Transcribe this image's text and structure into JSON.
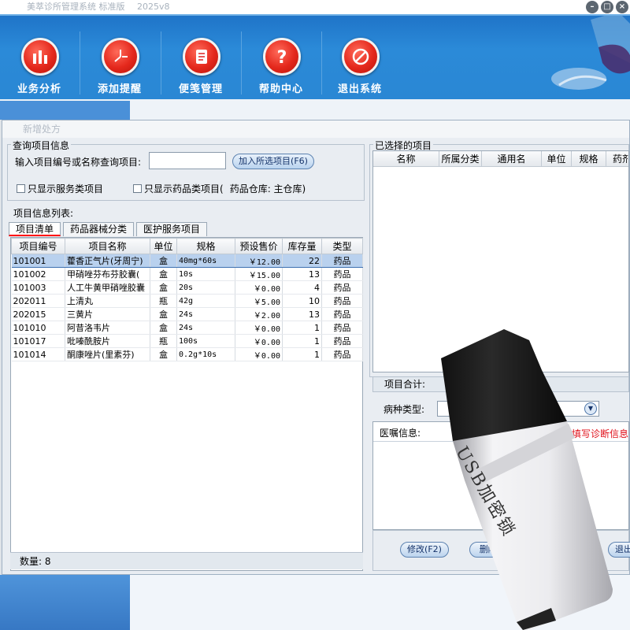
{
  "window": {
    "title": "美萃诊所管理系统 标准版",
    "version": "2025v8",
    "controls": [
      "minimize",
      "restore",
      "close"
    ]
  },
  "toolbar": {
    "buttons": [
      {
        "label": "业务分析",
        "icon": "bar-chart-icon"
      },
      {
        "label": "添加提醒",
        "icon": "clock-icon"
      },
      {
        "label": "便笺管理",
        "icon": "notepad-icon"
      },
      {
        "label": "帮助中心",
        "icon": "question-icon"
      },
      {
        "label": "退出系统",
        "icon": "no-entry-icon"
      }
    ]
  },
  "panel": {
    "title": "新增处方"
  },
  "query": {
    "group_title": "查询项目信息",
    "input_label": "输入项目编号或名称查询项目:",
    "input_value": "",
    "add_button": "加入所选项目(F6)",
    "only_service": "只显示服务类项目",
    "only_drug": "只显示药品类项目(",
    "warehouse": "药品仓库: 主仓库)"
  },
  "items": {
    "list_label": "项目信息列表:",
    "tabs": [
      "项目清单",
      "药品器械分类",
      "医护服务项目"
    ],
    "active_tab": 0,
    "columns": [
      "项目编号",
      "项目名称",
      "单位",
      "规格",
      "预设售价",
      "库存量",
      "类型"
    ],
    "rows": [
      {
        "code": "101001",
        "name": "藿香正气片(牙周宁)",
        "unit": "盒",
        "spec": "40mg*60s",
        "price": "￥12.00",
        "stock": "22",
        "type": "药品",
        "selected": true
      },
      {
        "code": "101002",
        "name": "甲硝唑芬布芬胶囊(",
        "unit": "盒",
        "spec": "10s",
        "price": "￥15.00",
        "stock": "13",
        "type": "药品"
      },
      {
        "code": "101003",
        "name": "人工牛黄甲硝唑胶囊",
        "unit": "盒",
        "spec": "20s",
        "price": "￥0.00",
        "stock": "4",
        "type": "药品"
      },
      {
        "code": "202011",
        "name": "上清丸",
        "unit": "瓶",
        "spec": "42g",
        "price": "￥5.00",
        "stock": "10",
        "type": "药品"
      },
      {
        "code": "202015",
        "name": "三黄片",
        "unit": "盒",
        "spec": "24s",
        "price": "￥2.00",
        "stock": "13",
        "type": "药品"
      },
      {
        "code": "101010",
        "name": "阿昔洛韦片",
        "unit": "盒",
        "spec": "24s",
        "price": "￥0.00",
        "stock": "1",
        "type": "药品"
      },
      {
        "code": "101017",
        "name": "吡嗪酰胺片",
        "unit": "瓶",
        "spec": "100s",
        "price": "￥0.00",
        "stock": "1",
        "type": "药品"
      },
      {
        "code": "101014",
        "name": "酮康唑片(里素芬)",
        "unit": "盒",
        "spec": "0.2g*10s",
        "price": "￥0.00",
        "stock": "1",
        "type": "药品"
      }
    ],
    "count_label": "数量: 8"
  },
  "selected": {
    "group_title": "已选择的项目",
    "columns": [
      "名称",
      "所属分类",
      "通用名",
      "单位",
      "规格",
      "药剂"
    ],
    "total_label": "项目合计:"
  },
  "diagnosis": {
    "disease_label": "病种类型:",
    "advice_label": "医嘱信息:",
    "advice_hint": "在此处填写诊断信息"
  },
  "actions": {
    "modify": "修改(F2)",
    "delete": "删除(F",
    "exit": "退出"
  },
  "overlay": {
    "usb_label": "USB加密锁"
  }
}
